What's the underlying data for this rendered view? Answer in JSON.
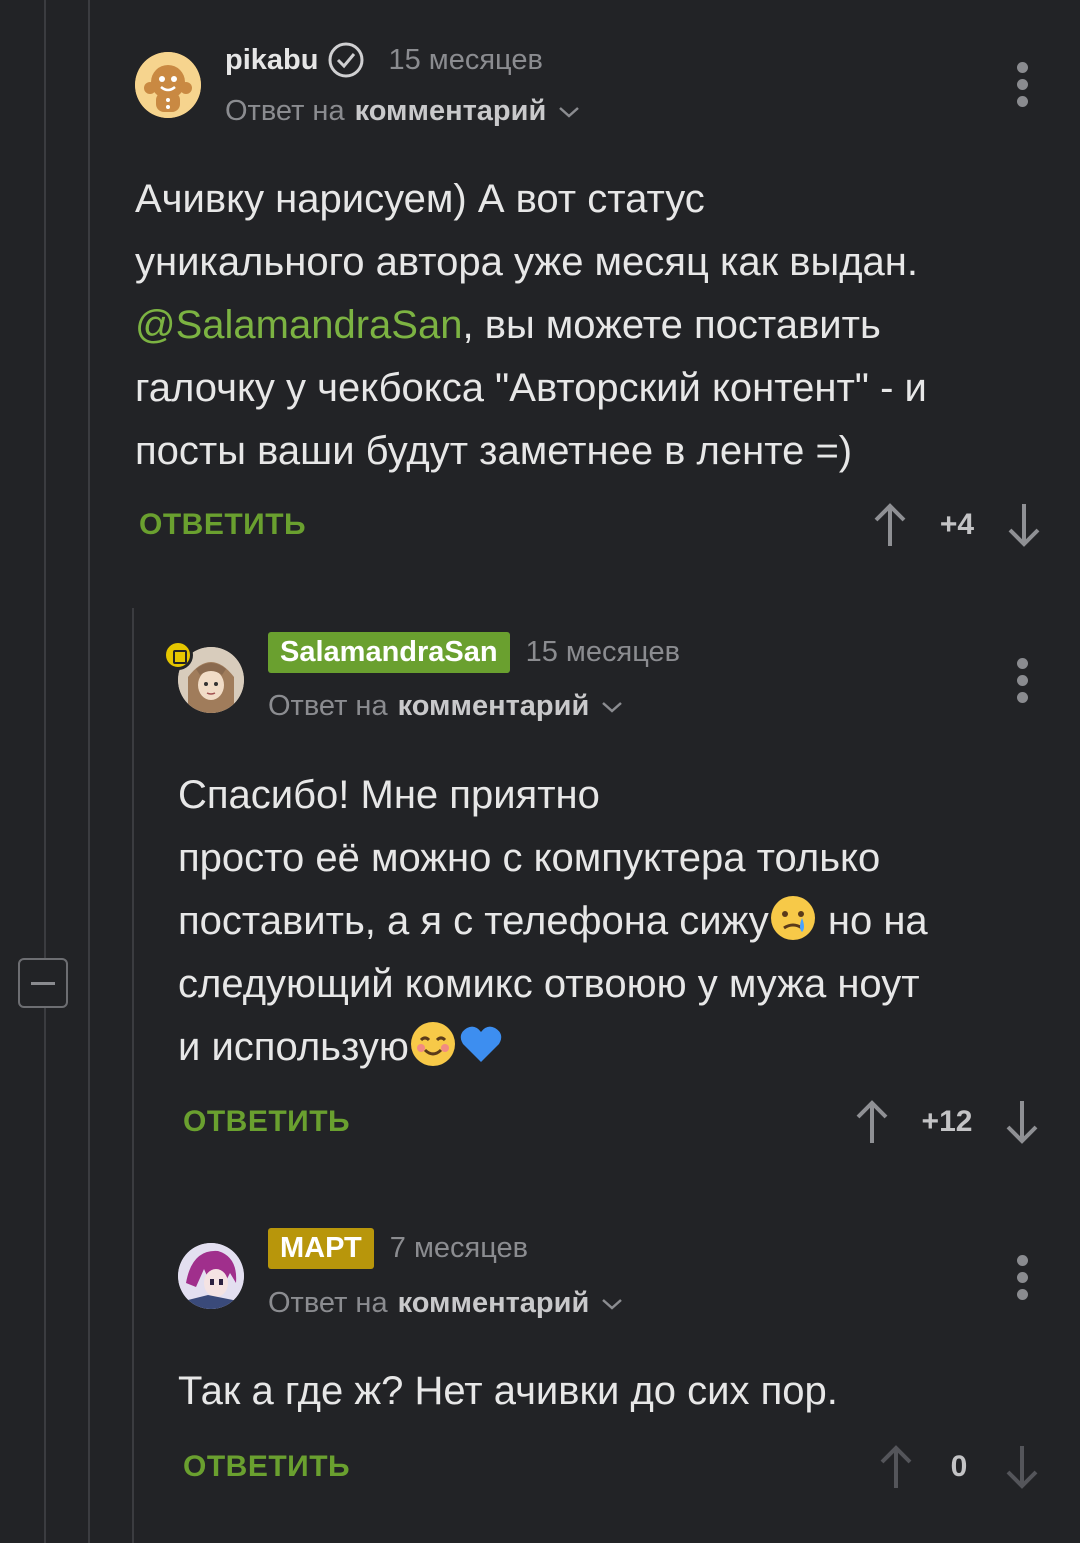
{
  "comments": [
    {
      "author": "pikabu",
      "time": "15 месяцев",
      "reply_prefix": "Ответ на",
      "reply_target": "комментарий",
      "text_before_mention": "Ачивку нарисуем) А вот статус\nуникального автора уже месяц как выдан.\n",
      "mention": "@SalamandraSan",
      "text_after_mention": ", вы можете поставить\nгалочку у чекбокса \"Авторский контент\" - и\nпосты ваши будут заметнее в ленте =)",
      "reply_label": "ОТВЕТИТЬ",
      "rating": "+4"
    },
    {
      "author": "SalamandraSan",
      "author_color": "#6aa02f",
      "time": "15 месяцев",
      "reply_prefix": "Ответ на",
      "reply_target": "комментарий",
      "line1": "Спасибо! Мне приятно",
      "line2": "просто её можно с компуктера только",
      "line3a": "поставить, а я с телефона сижу",
      "line3b": " но на",
      "line4": "следующий комикс отвоюю у мужа ноут",
      "line5": "и использую",
      "emoji": [
        "crying-face",
        "smiling-face",
        "blue-heart"
      ],
      "reply_label": "ОТВЕТИТЬ",
      "rating": "+12"
    },
    {
      "author": "МАРТ",
      "author_color": "#b8960b",
      "time": "7 месяцев",
      "reply_prefix": "Ответ на",
      "reply_target": "комментарий",
      "text": "Так а где ж? Нет ачивки до сих пор.",
      "reply_label": "ОТВЕТИТЬ",
      "rating": "0"
    }
  ],
  "colors": {
    "background": "#222326",
    "accent_green": "#6aa02f",
    "muted_text": "#8b8c90"
  }
}
